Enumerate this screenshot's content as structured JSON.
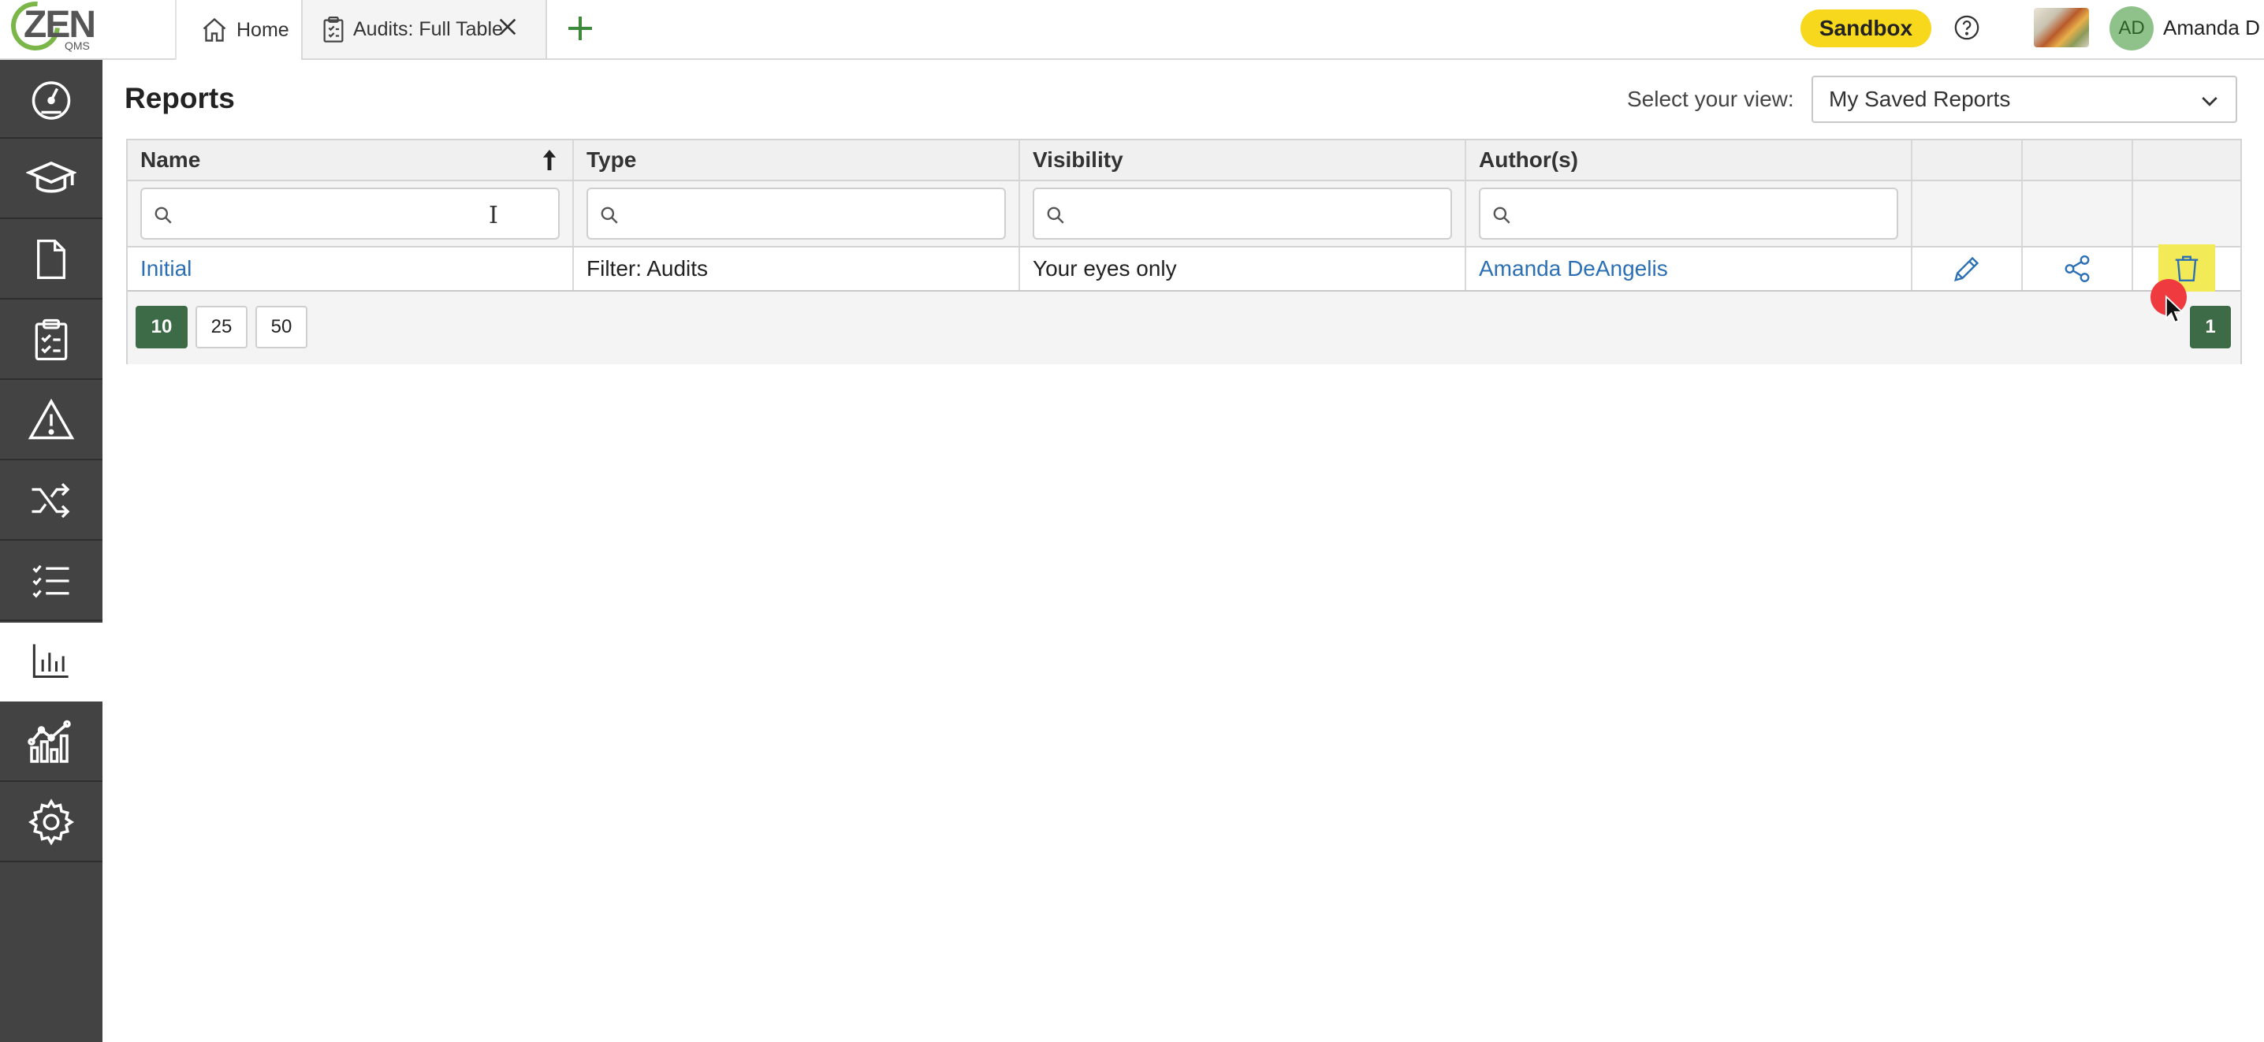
{
  "logo": {
    "text": "ZEN",
    "sub": "QMS"
  },
  "tabs": [
    {
      "label": "Home",
      "icon": "home-icon"
    },
    {
      "label": "Audits: Full Table",
      "icon": "clipboard-icon"
    }
  ],
  "header": {
    "sandbox_label": "Sandbox",
    "avatar_initials": "AD",
    "user_name": "Amanda D"
  },
  "sidebar": {
    "items": [
      {
        "name": "dashboard",
        "icon": "speedometer-icon"
      },
      {
        "name": "training",
        "icon": "graduation-cap-icon"
      },
      {
        "name": "documents",
        "icon": "document-icon"
      },
      {
        "name": "audits",
        "icon": "clipboard-checklist-icon"
      },
      {
        "name": "risk",
        "icon": "warning-icon"
      },
      {
        "name": "change",
        "icon": "shuffle-icon"
      },
      {
        "name": "tasks",
        "icon": "checklist-icon"
      },
      {
        "name": "reports",
        "icon": "bar-chart-icon",
        "active": true
      },
      {
        "name": "analytics",
        "icon": "line-chart-icon"
      },
      {
        "name": "settings",
        "icon": "gear-icon"
      }
    ]
  },
  "page": {
    "title": "Reports",
    "view_label": "Select your view:",
    "view_value": "My Saved Reports"
  },
  "table": {
    "columns": [
      "Name",
      "Type",
      "Visibility",
      "Author(s)"
    ],
    "rows": [
      {
        "name": "Initial",
        "type": "Filter: Audits",
        "visibility": "Your eyes only",
        "author": "Amanda DeAngelis"
      }
    ],
    "page_sizes": [
      "10",
      "25",
      "50"
    ],
    "active_page_size": "10",
    "current_page": "1"
  },
  "colors": {
    "accent_green": "#3d6b47",
    "link_blue": "#2b6fb5",
    "sandbox_yellow": "#f7d81c",
    "sidebar_bg": "#434343"
  }
}
